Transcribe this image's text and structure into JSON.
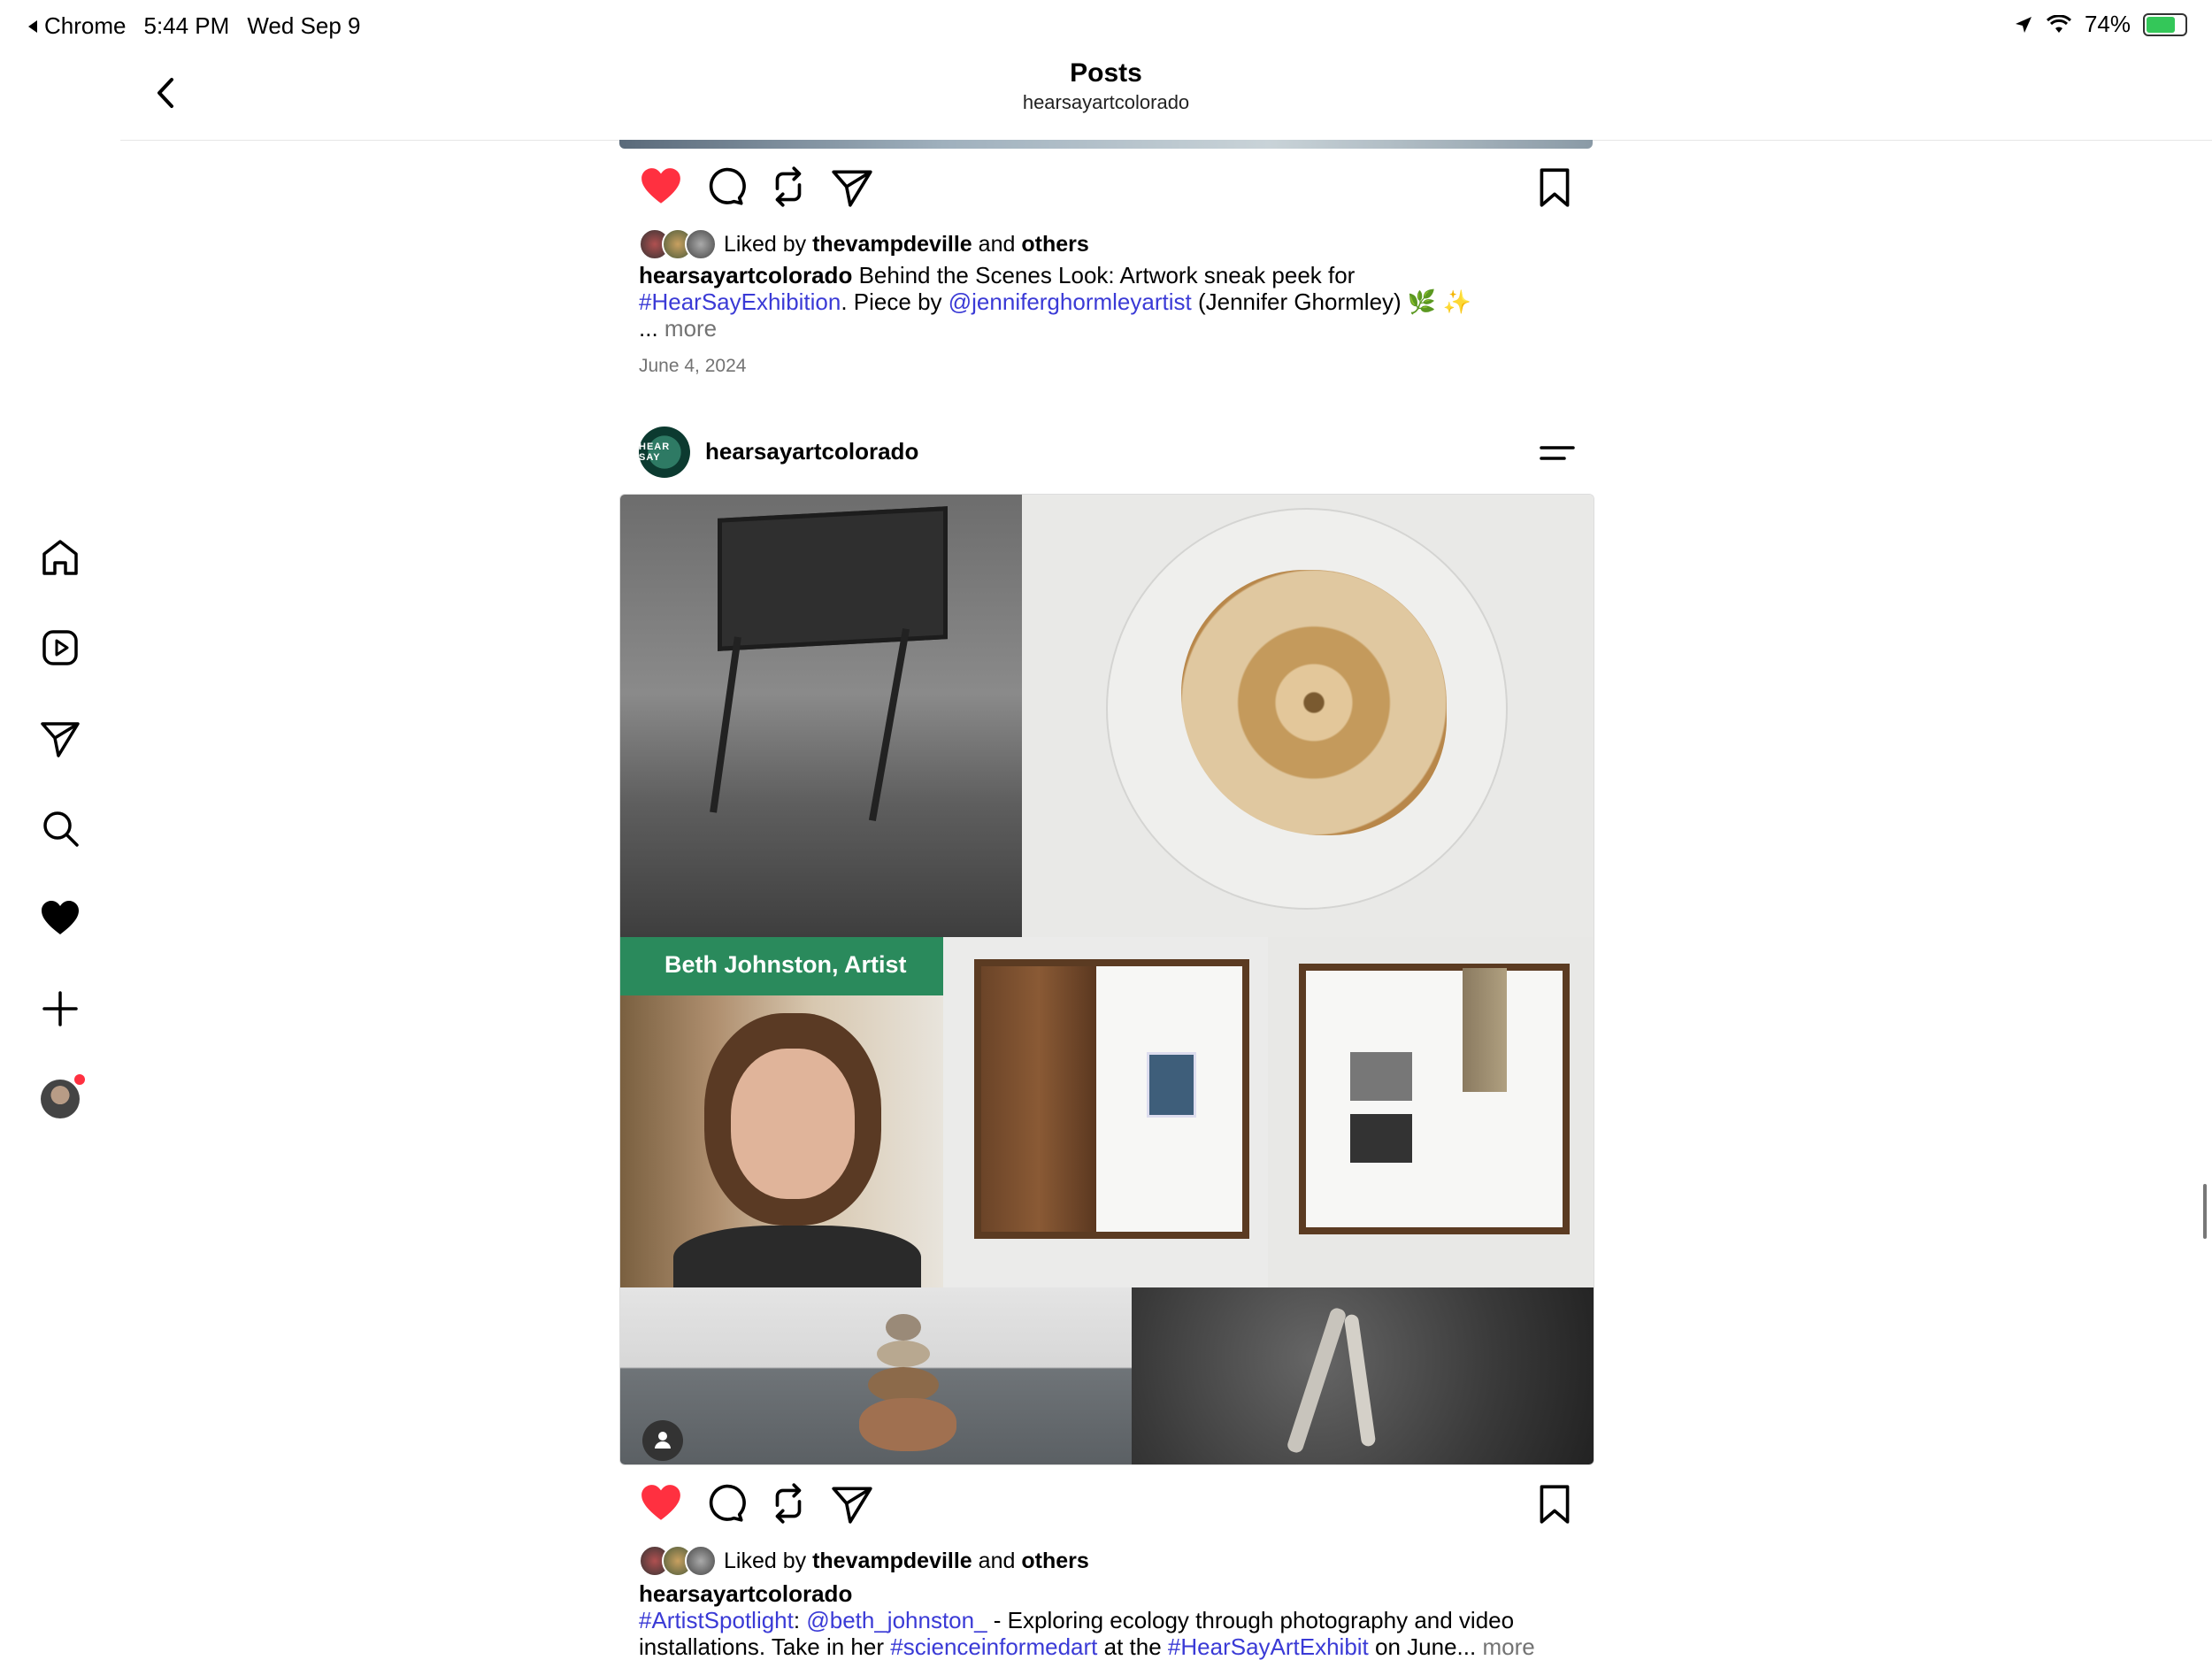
{
  "status_bar": {
    "back_app": "Chrome",
    "time": "5:44 PM",
    "date": "Wed Sep 9",
    "battery": "74%"
  },
  "header": {
    "title": "Posts",
    "subtitle": "hearsayartcolorado"
  },
  "sidebar": {
    "items": [
      {
        "name": "home",
        "icon": "home-icon"
      },
      {
        "name": "reels",
        "icon": "reels-icon"
      },
      {
        "name": "messages",
        "icon": "send-icon"
      },
      {
        "name": "search",
        "icon": "search-icon"
      },
      {
        "name": "activity",
        "icon": "heart-filled-icon"
      },
      {
        "name": "create",
        "icon": "plus-icon"
      },
      {
        "name": "profile",
        "icon": "avatar"
      }
    ]
  },
  "post1": {
    "liked_by_prefix": "Liked by",
    "liked_by_user": "thevampdeville",
    "liked_by_and": "and",
    "liked_by_others": "others",
    "caption_user": "hearsayartcolorado",
    "caption_text": "Behind the Scenes Look: Artwork sneak peek for",
    "hashtag": "#HearSayExhibition",
    "caption_text2": ". Piece by",
    "mention": "@jenniferghormleyartist",
    "caption_text3": "(Jennifer Ghormley) 🌿 ✨",
    "ellipsis": "...",
    "more": "more",
    "date": "June 4, 2024"
  },
  "post2": {
    "username": "hearsayartcolorado",
    "avatar_text": "HEAR SAY",
    "banner_label": "Beth Johnston, Artist",
    "liked_by_prefix": "Liked by",
    "liked_by_user": "thevampdeville",
    "liked_by_and": "and",
    "liked_by_others": "others",
    "caption_user": "hearsayartcolorado",
    "hashtag1": "#ArtistSpotlight",
    "colon": ":",
    "mention": "@beth_johnston_",
    "text1": "- Exploring ecology through photography and video",
    "text2": "installations. Take in her",
    "hashtag2": "#scienceinformedart",
    "text3": "at the",
    "hashtag3": "#HearSayArtExhibit",
    "text4": "on June...",
    "more": "more"
  },
  "colors": {
    "like_red": "#ff3040",
    "link_blue": "#3a3ad6",
    "muted_gray": "#737373",
    "banner_green": "#2a8a5c"
  }
}
